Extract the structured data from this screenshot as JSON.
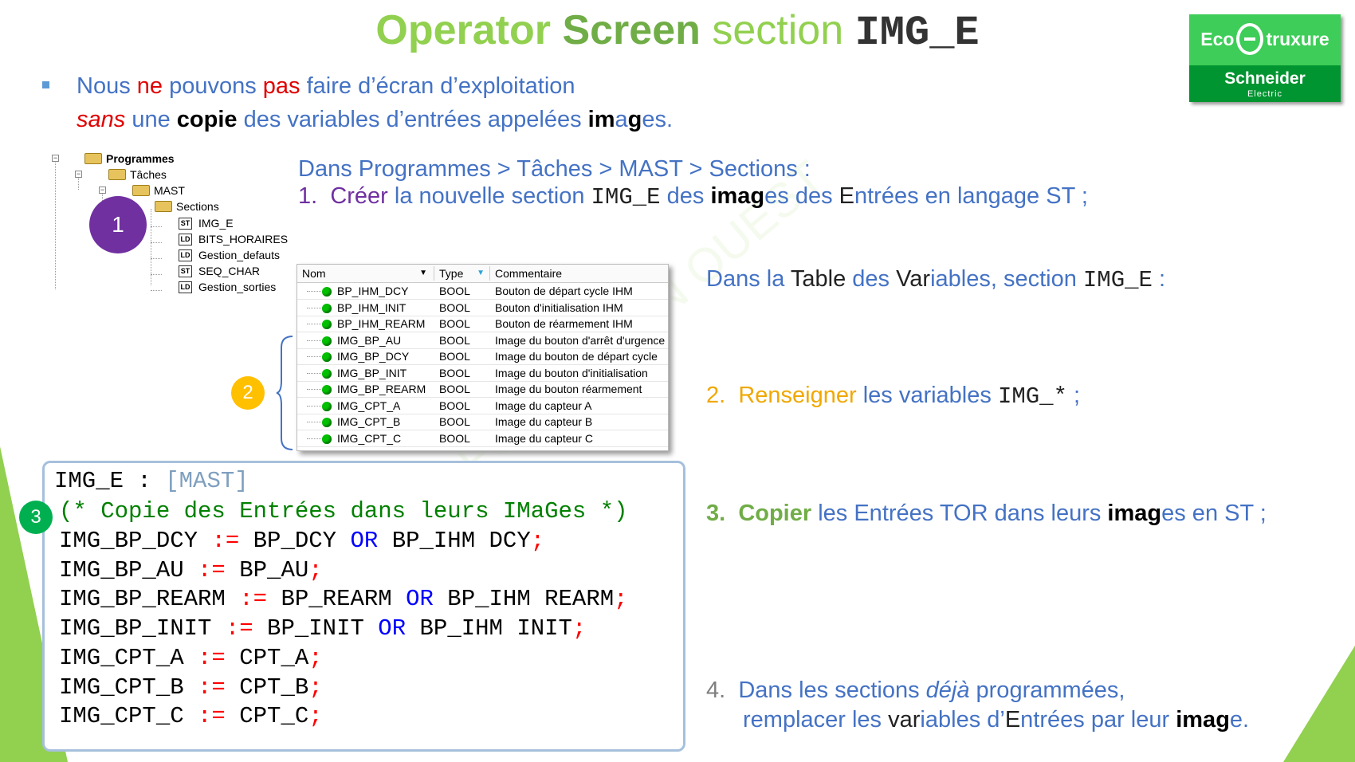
{
  "title": {
    "part1": "Operator",
    "part2": "Screen",
    "part3": "section",
    "part4": "IMG_E"
  },
  "logo": {
    "brand_top_left": "Eco",
    "brand_top_right": "truxure",
    "brand_bottom": "Schneider",
    "brand_sub": "Electric"
  },
  "intro": {
    "line1": [
      {
        "text": "Nous ",
        "style": "blue"
      },
      {
        "text": "ne",
        "style": "red"
      },
      {
        "text": " pouvons ",
        "style": "blue"
      },
      {
        "text": "pas",
        "style": "red"
      },
      {
        "text": " faire d’écran d’exploitation",
        "style": "blue"
      }
    ],
    "line2": [
      {
        "text": "sans",
        "style": "red-italic"
      },
      {
        "text": " une ",
        "style": "blue"
      },
      {
        "text": "copie",
        "style": "black-bold"
      },
      {
        "text": " des variables d’entrées appelées ",
        "style": "blue"
      },
      {
        "text": "im",
        "style": "black-bold"
      },
      {
        "text": "a",
        "style": "blue"
      },
      {
        "text": "g",
        "style": "black-bold"
      },
      {
        "text": "es.",
        "style": "blue"
      }
    ]
  },
  "tree": {
    "root": "Programmes",
    "tasks": "Tâches",
    "mast": "MAST",
    "sections": "Sections",
    "items": [
      {
        "icon": "ST",
        "label": "IMG_E"
      },
      {
        "icon": "LD",
        "label": "BITS_HORAIRES"
      },
      {
        "icon": "LD",
        "label": "Gestion_defauts"
      },
      {
        "icon": "ST",
        "label": "SEQ_CHAR"
      },
      {
        "icon": "LD",
        "label": "Gestion_sorties"
      }
    ]
  },
  "circles": {
    "one": "1",
    "two": "2",
    "three": "3"
  },
  "steps": {
    "path": "Dans Programmes > Tâches > MAST > Sections :",
    "step1": {
      "num": "1.",
      "a": "Créer",
      "b": " la nouvelle section ",
      "c": "IMG_E",
      "d": " des ",
      "e": "ima",
      "f": "g",
      "g": "es des ",
      "h": "E",
      "i": "ntrées en langage ST ;"
    },
    "table_intro": {
      "a": "Dans la ",
      "b": "Table",
      "c": " des ",
      "d": "Var",
      "e": "iables, section ",
      "f": "IMG_E",
      "g": " :"
    },
    "step2": {
      "num": "2.",
      "a": "Renseigner",
      "b": " les variables ",
      "c": "IMG_*",
      "d": " ;"
    },
    "step3": {
      "num": "3.",
      "a": "Copier",
      "b": " les Entrées TOR dans leurs ",
      "c": "ima",
      "d": "g",
      "e": "es en ST ;"
    },
    "step4": {
      "num": "4.",
      "line1a": "Dans les sections ",
      "line1b": "déjà",
      "line1c": " programmées,",
      "line2a": "remplacer les ",
      "line2b": "var",
      "line2c": "iables d’",
      "line2d": "E",
      "line2e": "ntrées par leur ",
      "line2f": "ima",
      "line2g": "g",
      "line2h": "e."
    }
  },
  "var_table": {
    "headers": [
      "Nom",
      "Type",
      "Commentaire"
    ],
    "rows": [
      {
        "name": "BP_IHM_DCY",
        "type": "BOOL",
        "comment": "Bouton de départ cycle IHM"
      },
      {
        "name": "BP_IHM_INIT",
        "type": "BOOL",
        "comment": "Bouton d'initialisation IHM"
      },
      {
        "name": "BP_IHM_REARM",
        "type": "BOOL",
        "comment": "Bouton de réarmement IHM"
      },
      {
        "name": "IMG_BP_AU",
        "type": "BOOL",
        "comment": "Image du bouton d'arrêt d'urgence"
      },
      {
        "name": "IMG_BP_DCY",
        "type": "BOOL",
        "comment": "Image du bouton de départ cycle"
      },
      {
        "name": "IMG_BP_INIT",
        "type": "BOOL",
        "comment": "Image du bouton d'initialisation"
      },
      {
        "name": "IMG_BP_REARM",
        "type": "BOOL",
        "comment": "Image du bouton réarmement"
      },
      {
        "name": "IMG_CPT_A",
        "type": "BOOL",
        "comment": "Image du capteur A"
      },
      {
        "name": "IMG_CPT_B",
        "type": "BOOL",
        "comment": "Image du capteur B"
      },
      {
        "name": "IMG_CPT_C",
        "type": "BOOL",
        "comment": "Image du capteur C"
      }
    ]
  },
  "code": {
    "header_name": "IMG_E : ",
    "header_task": "[MAST]",
    "comment": "(* Copie des Entrées dans leurs IMaGes *)",
    "lines": [
      {
        "lhs": "IMG_BP_DCY ",
        "op": ":=",
        "rhs1": " BP_DCY ",
        "kw": "OR",
        "rhs2": " BP_IHM DCY",
        "end": ";"
      },
      {
        "lhs": "IMG_BP_AU ",
        "op": ":=",
        "rhs1": " BP_AU",
        "kw": "",
        "rhs2": "",
        "end": ";"
      },
      {
        "lhs": "IMG_BP_REARM ",
        "op": ":=",
        "rhs1": " BP_REARM ",
        "kw": "OR",
        "rhs2": " BP_IHM REARM",
        "end": ";"
      },
      {
        "lhs": "IMG_BP_INIT ",
        "op": ":=",
        "rhs1": " BP_INIT ",
        "kw": "OR",
        "rhs2": " BP_IHM INIT",
        "end": ";"
      },
      {
        "lhs": "IMG_CPT_A ",
        "op": ":=",
        "rhs1": " CPT_A",
        "kw": "",
        "rhs2": "",
        "end": ";"
      },
      {
        "lhs": "IMG_CPT_B ",
        "op": ":=",
        "rhs1": " CPT_B",
        "kw": "",
        "rhs2": "",
        "end": ";"
      },
      {
        "lhs": "IMG_CPT_C ",
        "op": ":=",
        "rhs1": " CPT_C",
        "kw": "",
        "rhs2": "",
        "end": ";"
      }
    ]
  },
  "watermark": "FORMATION OUEST",
  "colors": {
    "title_light": "#92d050",
    "title_dark": "#70ad47",
    "blue": "#4472c4",
    "red": "#e00000",
    "purple": "#7030a0",
    "gold": "#f0a800",
    "green": "#70ad47",
    "logo_green": "#3dcd58",
    "logo_dark": "#009530"
  }
}
